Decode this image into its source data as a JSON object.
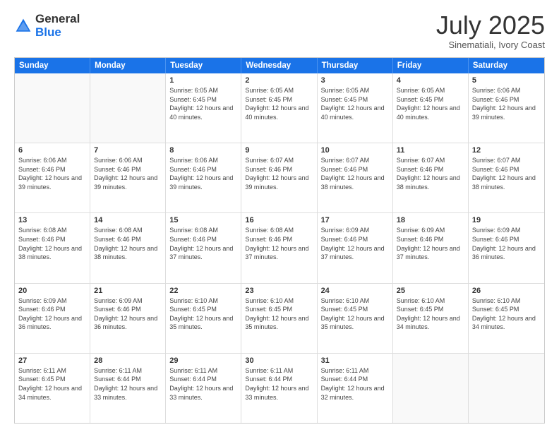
{
  "header": {
    "logo_general": "General",
    "logo_blue": "Blue",
    "month": "July 2025",
    "location": "Sinematiali, Ivory Coast"
  },
  "days_of_week": [
    "Sunday",
    "Monday",
    "Tuesday",
    "Wednesday",
    "Thursday",
    "Friday",
    "Saturday"
  ],
  "weeks": [
    [
      {
        "day": "",
        "empty": true
      },
      {
        "day": "",
        "empty": true
      },
      {
        "day": "1",
        "sunrise": "6:05 AM",
        "sunset": "6:45 PM",
        "daylight": "12 hours and 40 minutes."
      },
      {
        "day": "2",
        "sunrise": "6:05 AM",
        "sunset": "6:45 PM",
        "daylight": "12 hours and 40 minutes."
      },
      {
        "day": "3",
        "sunrise": "6:05 AM",
        "sunset": "6:45 PM",
        "daylight": "12 hours and 40 minutes."
      },
      {
        "day": "4",
        "sunrise": "6:05 AM",
        "sunset": "6:45 PM",
        "daylight": "12 hours and 40 minutes."
      },
      {
        "day": "5",
        "sunrise": "6:06 AM",
        "sunset": "6:46 PM",
        "daylight": "12 hours and 39 minutes."
      }
    ],
    [
      {
        "day": "6",
        "sunrise": "6:06 AM",
        "sunset": "6:46 PM",
        "daylight": "12 hours and 39 minutes."
      },
      {
        "day": "7",
        "sunrise": "6:06 AM",
        "sunset": "6:46 PM",
        "daylight": "12 hours and 39 minutes."
      },
      {
        "day": "8",
        "sunrise": "6:06 AM",
        "sunset": "6:46 PM",
        "daylight": "12 hours and 39 minutes."
      },
      {
        "day": "9",
        "sunrise": "6:07 AM",
        "sunset": "6:46 PM",
        "daylight": "12 hours and 39 minutes."
      },
      {
        "day": "10",
        "sunrise": "6:07 AM",
        "sunset": "6:46 PM",
        "daylight": "12 hours and 38 minutes."
      },
      {
        "day": "11",
        "sunrise": "6:07 AM",
        "sunset": "6:46 PM",
        "daylight": "12 hours and 38 minutes."
      },
      {
        "day": "12",
        "sunrise": "6:07 AM",
        "sunset": "6:46 PM",
        "daylight": "12 hours and 38 minutes."
      }
    ],
    [
      {
        "day": "13",
        "sunrise": "6:08 AM",
        "sunset": "6:46 PM",
        "daylight": "12 hours and 38 minutes."
      },
      {
        "day": "14",
        "sunrise": "6:08 AM",
        "sunset": "6:46 PM",
        "daylight": "12 hours and 38 minutes."
      },
      {
        "day": "15",
        "sunrise": "6:08 AM",
        "sunset": "6:46 PM",
        "daylight": "12 hours and 37 minutes."
      },
      {
        "day": "16",
        "sunrise": "6:08 AM",
        "sunset": "6:46 PM",
        "daylight": "12 hours and 37 minutes."
      },
      {
        "day": "17",
        "sunrise": "6:09 AM",
        "sunset": "6:46 PM",
        "daylight": "12 hours and 37 minutes."
      },
      {
        "day": "18",
        "sunrise": "6:09 AM",
        "sunset": "6:46 PM",
        "daylight": "12 hours and 37 minutes."
      },
      {
        "day": "19",
        "sunrise": "6:09 AM",
        "sunset": "6:46 PM",
        "daylight": "12 hours and 36 minutes."
      }
    ],
    [
      {
        "day": "20",
        "sunrise": "6:09 AM",
        "sunset": "6:46 PM",
        "daylight": "12 hours and 36 minutes."
      },
      {
        "day": "21",
        "sunrise": "6:09 AM",
        "sunset": "6:46 PM",
        "daylight": "12 hours and 36 minutes."
      },
      {
        "day": "22",
        "sunrise": "6:10 AM",
        "sunset": "6:45 PM",
        "daylight": "12 hours and 35 minutes."
      },
      {
        "day": "23",
        "sunrise": "6:10 AM",
        "sunset": "6:45 PM",
        "daylight": "12 hours and 35 minutes."
      },
      {
        "day": "24",
        "sunrise": "6:10 AM",
        "sunset": "6:45 PM",
        "daylight": "12 hours and 35 minutes."
      },
      {
        "day": "25",
        "sunrise": "6:10 AM",
        "sunset": "6:45 PM",
        "daylight": "12 hours and 34 minutes."
      },
      {
        "day": "26",
        "sunrise": "6:10 AM",
        "sunset": "6:45 PM",
        "daylight": "12 hours and 34 minutes."
      }
    ],
    [
      {
        "day": "27",
        "sunrise": "6:11 AM",
        "sunset": "6:45 PM",
        "daylight": "12 hours and 34 minutes."
      },
      {
        "day": "28",
        "sunrise": "6:11 AM",
        "sunset": "6:44 PM",
        "daylight": "12 hours and 33 minutes."
      },
      {
        "day": "29",
        "sunrise": "6:11 AM",
        "sunset": "6:44 PM",
        "daylight": "12 hours and 33 minutes."
      },
      {
        "day": "30",
        "sunrise": "6:11 AM",
        "sunset": "6:44 PM",
        "daylight": "12 hours and 33 minutes."
      },
      {
        "day": "31",
        "sunrise": "6:11 AM",
        "sunset": "6:44 PM",
        "daylight": "12 hours and 32 minutes."
      },
      {
        "day": "",
        "empty": true
      },
      {
        "day": "",
        "empty": true
      }
    ]
  ]
}
